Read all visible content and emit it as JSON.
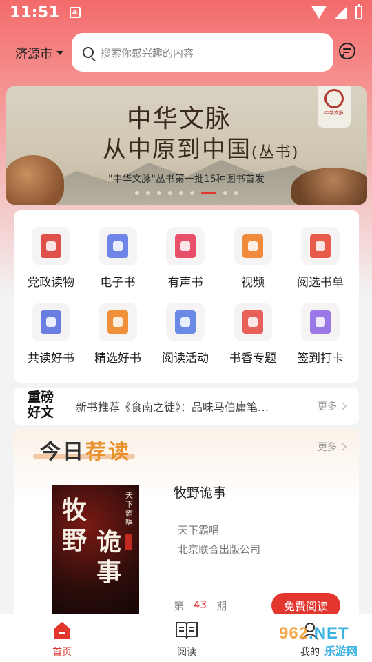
{
  "status_bar": {
    "time": "11:51",
    "notification_icon": "A"
  },
  "header": {
    "city": "济源市",
    "search_placeholder": "搜索你感兴趣的内容"
  },
  "banner": {
    "title_line1": "中华文脉",
    "title_line2": "从中原到中国",
    "title_suffix": "(丛书)",
    "subtitle": "\"中华文脉\"丛书第一批15种图书首发",
    "seal_text": "中华文脉",
    "slide_count": 9,
    "active_slide": 6
  },
  "categories": [
    {
      "label": "党政读物",
      "icon": "red-book-icon",
      "color": "#e0504a"
    },
    {
      "label": "电子书",
      "icon": "ebook-play-icon",
      "color": "#6f86e8"
    },
    {
      "label": "有声书",
      "icon": "music-book-icon",
      "color": "#e8506a"
    },
    {
      "label": "视频",
      "icon": "video-play-icon",
      "color": "#f08a3c"
    },
    {
      "label": "阅选书单",
      "icon": "book-stack-icon",
      "color": "#e85a4a"
    },
    {
      "label": "共读好书",
      "icon": "blue-book-icon",
      "color": "#6a7de0"
    },
    {
      "label": "精选好书",
      "icon": "thumb-book-icon",
      "color": "#f0903a"
    },
    {
      "label": "阅读活动",
      "icon": "award-badge-icon",
      "color": "#6a8ae6"
    },
    {
      "label": "书香专题",
      "icon": "open-book-icon",
      "color": "#e8605a"
    },
    {
      "label": "签到打卡",
      "icon": "calendar-check-icon",
      "color": "#9a78e6"
    }
  ],
  "news": {
    "logo_line1": "重磅",
    "logo_line2": "好文",
    "text": "新书推荐《食南之徒》：品味马伯庸笔…",
    "more": "更多"
  },
  "recommend": {
    "title_a": "今日",
    "title_b": "荐读",
    "more": "更多",
    "book": {
      "title": "牧野诡事",
      "author": "天下霸唱",
      "publisher": "北京联合出版公司",
      "cover_title": "牧野诡事",
      "cover_author": "天下霸唱",
      "issue_prefix": "第",
      "issue_number": "43",
      "issue_suffix": "期",
      "read_button": "免费阅读"
    }
  },
  "tabbar": {
    "home": "首页",
    "read": "阅读",
    "mine": "我的"
  },
  "watermark": {
    "brand_a": "962",
    "brand_b": ".NET",
    "brand_cn": "乐游网"
  },
  "colors": {
    "accent": "#e2362f",
    "header_top": "#f36b6b",
    "recommend_highlight": "#e8902a"
  }
}
